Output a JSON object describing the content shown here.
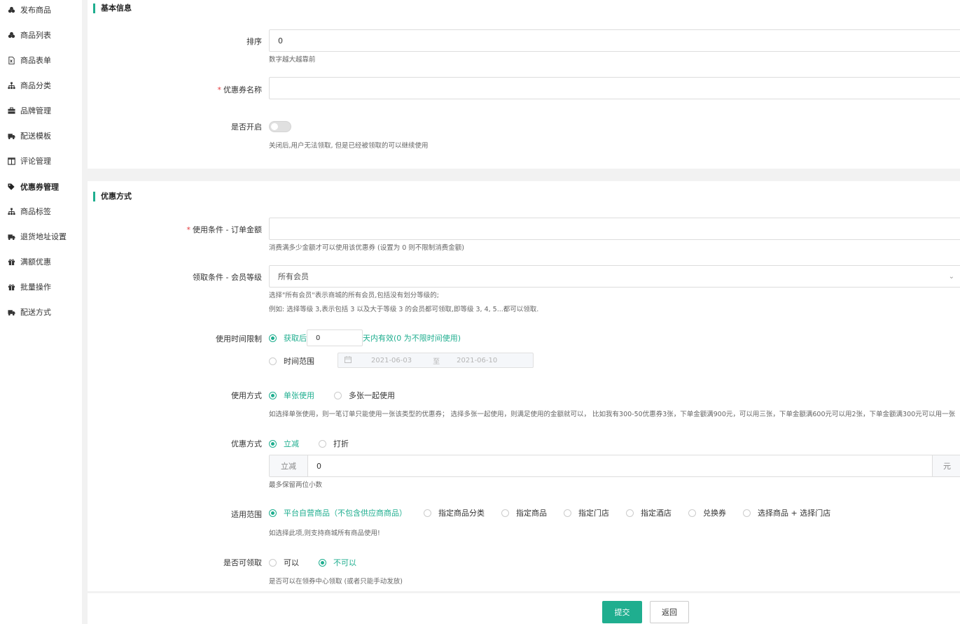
{
  "sidebar": {
    "items": [
      {
        "label": "发布商品",
        "icon": "cubes-icon"
      },
      {
        "label": "商品列表",
        "icon": "cubes-icon"
      },
      {
        "label": "商品表单",
        "icon": "file-icon"
      },
      {
        "label": "商品分类",
        "icon": "sitemap-icon"
      },
      {
        "label": "品牌管理",
        "icon": "briefcase-icon"
      },
      {
        "label": "配送模板",
        "icon": "truck-icon"
      },
      {
        "label": "评论管理",
        "icon": "columns-icon"
      },
      {
        "label": "优惠券管理",
        "icon": "tags-icon",
        "active": true
      },
      {
        "label": "商品标签",
        "icon": "sitemap-icon"
      },
      {
        "label": "退货地址设置",
        "icon": "truck-icon"
      },
      {
        "label": "满额优惠",
        "icon": "gift-icon"
      },
      {
        "label": "批量操作",
        "icon": "gift-icon"
      },
      {
        "label": "配送方式",
        "icon": "truck-icon"
      }
    ]
  },
  "basic": {
    "title": "基本信息",
    "sort": {
      "label": "排序",
      "value": "0",
      "help": "数字越大越靠前"
    },
    "name": {
      "label": "优惠券名称",
      "value": ""
    },
    "enabled": {
      "label": "是否开启",
      "help": "关闭后,用户无法领取, 但是已经被领取的可以继续使用"
    }
  },
  "coupon": {
    "title": "优惠方式",
    "order_amount": {
      "label": "使用条件 - 订单金额",
      "value": "",
      "help": "消费满多少金额才可以使用该优惠券 (设置为 0 则不限制消费金额)"
    },
    "member_level": {
      "label": "领取条件 - 会员等级",
      "value": "所有会员",
      "help1": "选择\"所有会员\"表示商城的所有会员,包括没有划分等级的;",
      "help2": "例如: 选择等级 3,表示包括 3 以及大于等级 3 的会员都可领取,即等级 3, 4, 5...都可以领取."
    },
    "time_limit": {
      "label": "使用时间限制",
      "option1_prefix": "获取后",
      "days_value": "0",
      "option1_suffix": "天内有效(0 为不限时间使用)",
      "option2": "时间范围",
      "start_date": "2021-06-03",
      "range_sep": "至",
      "end_date": "2021-06-10"
    },
    "usage": {
      "label": "使用方式",
      "option1": "单张使用",
      "option2": "多张一起使用",
      "help": "如选择单张使用，则一笔订单只能使用一张该类型的优惠券； 选择多张一起使用，则满足使用的金额就可以， 比如我有300-50优惠券3张，下单金额满900元，可以用三张，下单金额满600元可以用2张，下单金额满300元可以用一张"
    },
    "discount": {
      "label": "优惠方式",
      "option1": "立减",
      "option2": "打折",
      "prefix": "立减",
      "value": "0",
      "suffix": "元",
      "help": "最多保留两位小数"
    },
    "scope": {
      "label": "适用范围",
      "options": [
        "平台自营商品（不包含供应商商品）",
        "指定商品分类",
        "指定商品",
        "指定门店",
        "指定酒店",
        "兑换券",
        "选择商品 + 选择门店"
      ],
      "help": "如选择此项,则支持商城所有商品使用!"
    },
    "receivable": {
      "label": "是否可领取",
      "option1": "可以",
      "option2": "不可以",
      "help": "是否可以在领券中心领取 (或者只能手动发放)"
    }
  },
  "footer": {
    "submit": "提交",
    "back": "返回"
  },
  "colors": {
    "accent": "#1fae8f",
    "required": "#e4393c"
  }
}
